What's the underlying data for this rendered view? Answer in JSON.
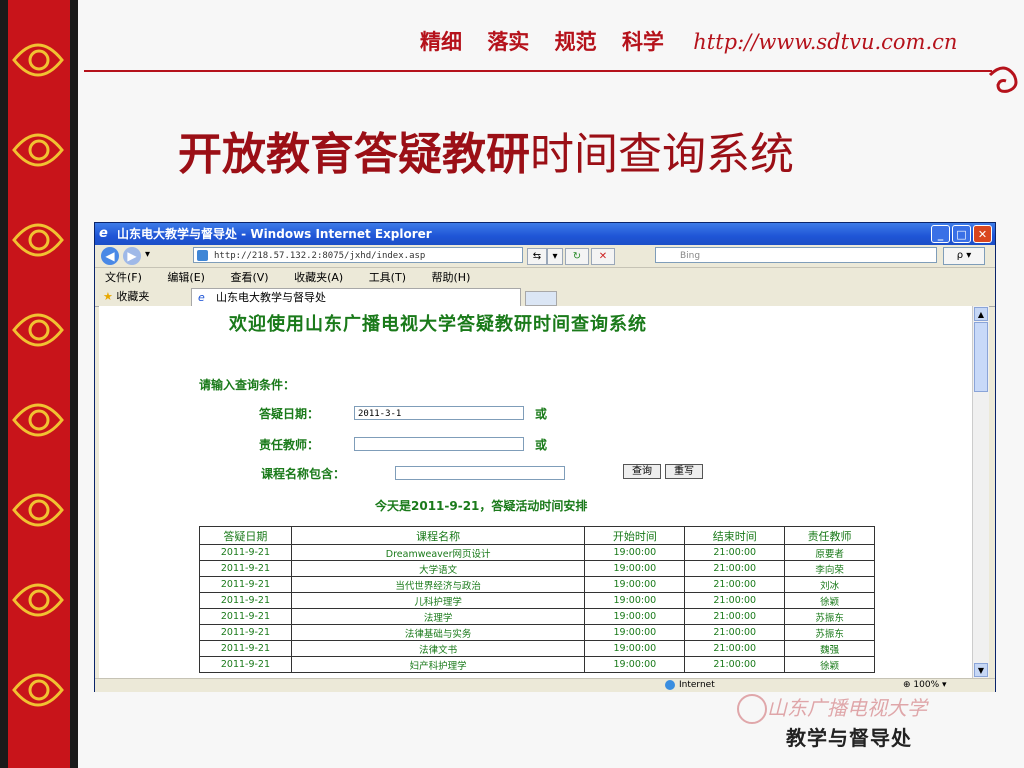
{
  "slide": {
    "slogans": [
      "精细",
      "落实",
      "规范",
      "科学"
    ],
    "url": "http://www.sdtvu.com.cn",
    "title_bold": "开放教育答疑教研",
    "title_rest": "时间查询系统",
    "watermark": "山东广播电视大学",
    "department": "教学与督导处"
  },
  "browser": {
    "window_title": "山东电大教学与督导处 - Windows Internet Explorer",
    "address": "http://218.57.132.2:8075/jxhd/index.asp",
    "search_placeholder": "Bing",
    "search_go": "ρ ▾",
    "menu": [
      "文件(F)",
      "编辑(E)",
      "查看(V)",
      "收藏夹(A)",
      "工具(T)",
      "帮助(H)"
    ],
    "favorites_label": "收藏夹",
    "tab_label": "山东电大教学与督导处",
    "status_zone": "Internet",
    "zoom": "100%"
  },
  "page": {
    "welcome": "欢迎使用山东广播电视大学答疑教研时间查询系统",
    "prompt": "请输入查询条件：",
    "date_label": "答疑日期：",
    "date_value": "2011-3-1",
    "or_label": "或",
    "teacher_label": "责任教师：",
    "teacher_value": "",
    "course_label": "课程名称包含：",
    "course_value": "",
    "query_btn": "查询",
    "reset_btn": "重写",
    "today": "今天是2011-9-21，答疑活动时间安排"
  },
  "table": {
    "headers": [
      "答疑日期",
      "课程名称",
      "开始时间",
      "结束时间",
      "责任教师"
    ],
    "rows": [
      [
        "2011-9-21",
        "Dreamweaver网页设计",
        "19:00:00",
        "21:00:00",
        "原要者"
      ],
      [
        "2011-9-21",
        "大学语文",
        "19:00:00",
        "21:00:00",
        "李向荣"
      ],
      [
        "2011-9-21",
        "当代世界经济与政治",
        "19:00:00",
        "21:00:00",
        "刘冰"
      ],
      [
        "2011-9-21",
        "儿科护理学",
        "19:00:00",
        "21:00:00",
        "徐颖"
      ],
      [
        "2011-9-21",
        "法理学",
        "19:00:00",
        "21:00:00",
        "苏振东"
      ],
      [
        "2011-9-21",
        "法律基础与实务",
        "19:00:00",
        "21:00:00",
        "苏振东"
      ],
      [
        "2011-9-21",
        "法律文书",
        "19:00:00",
        "21:00:00",
        "魏强"
      ],
      [
        "2011-9-21",
        "妇产科护理学",
        "19:00:00",
        "21:00:00",
        "徐颖"
      ]
    ]
  },
  "colors": {
    "brand_red": "#b5121b",
    "page_green": "#1a7a1a",
    "xp_blue": "#1f55d6"
  },
  "icons": [
    "ie-icon",
    "back-icon",
    "forward-icon",
    "refresh-icon",
    "stop-icon",
    "star-icon",
    "globe-icon",
    "minimize-icon",
    "maximize-icon",
    "close-icon"
  ]
}
